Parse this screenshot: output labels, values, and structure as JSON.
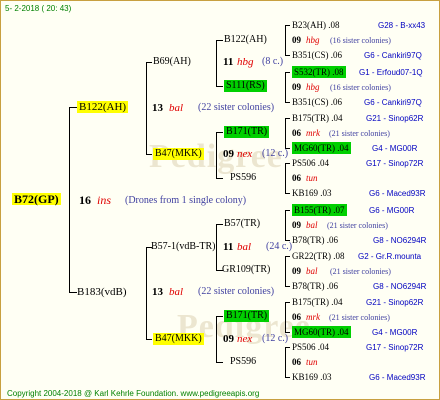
{
  "header": {
    "date": "5- 2-2018 ( 20: 43)"
  },
  "watermark": "Pedigree",
  "gen1": {
    "id": "B72(GP)",
    "num": "16",
    "mark": "ins",
    "note": "(Drones from 1 single colony)"
  },
  "gen2": [
    {
      "id": "B122(AH)",
      "num": "13",
      "mark": "bal",
      "note": "(22 sister colonies)"
    },
    {
      "id": "B183(vdB)",
      "num": "13",
      "mark": "bal",
      "note": "(22 sister colonies)"
    }
  ],
  "gen3": [
    {
      "id": "B69(AH)",
      "num": "11",
      "mark": "hbg",
      "note": "(8 c.)"
    },
    {
      "id": "B47(MKK)",
      "num": "09",
      "mark": "nex",
      "note": "(12 c.)"
    },
    {
      "id": "B57-1(vdB-TR)",
      "num": "11",
      "mark": "bal",
      "note": "(24 c.)"
    },
    {
      "id": "B47(MKK)",
      "num": "09",
      "mark": "nex",
      "note": "(12 c.)"
    }
  ],
  "gen4": [
    "B122(AH)",
    "S111(RS)",
    "B171(TR)",
    "PS596",
    "B57(TR)",
    "GR109(TR)",
    "B171(TR)",
    "PS596"
  ],
  "gen5": [
    {
      "id": "B23(AH) .08",
      "loc": "G28 - B-xx43"
    },
    {
      "num": "09",
      "mark": "hbg",
      "note": "(16 sister colonies)"
    },
    {
      "id": "B351(CS) .06",
      "loc": "G6 - Cankiri97Q"
    },
    {
      "id": "S532(TR) .08",
      "loc": "G1 - Erfoud07-1Q"
    },
    {
      "num": "09",
      "mark": "hbg",
      "note": "(16 sister colonies)"
    },
    {
      "id": "B351(CS) .06",
      "loc": "G6 - Cankiri97Q"
    },
    {
      "id": "B175(TR) .04",
      "loc": "G21 - Sinop62R"
    },
    {
      "num": "06",
      "mark": "mrk",
      "note": "(21 sister colonies)"
    },
    {
      "id": "MG60(TR) .04",
      "loc": "G4 - MG00R"
    },
    {
      "id": "PS506 .04",
      "loc": "G17 - Sinop72R"
    },
    {
      "num": "06",
      "mark": "tun",
      "note": ""
    },
    {
      "id": "KB169 .03",
      "loc": "G6 - Maced93R"
    },
    {
      "id": "B155(TR) .07",
      "loc": "G6 - MG00R"
    },
    {
      "num": "09",
      "mark": "bal",
      "note": "(21 sister colonies)"
    },
    {
      "id": "B78(TR) .06",
      "loc": "G8 - NO6294R"
    },
    {
      "id": "GR22(TR) .08",
      "loc": "G2 - Gr.R.mounta"
    },
    {
      "num": "09",
      "mark": "bal",
      "note": "(21 sister colonies)"
    },
    {
      "id": "B78(TR) .06",
      "loc": "G8 - NO6294R"
    },
    {
      "id": "B175(TR) .04",
      "loc": "G21 - Sinop62R"
    },
    {
      "num": "06",
      "mark": "mrk",
      "note": "(21 sister colonies)"
    },
    {
      "id": "MG60(TR) .04",
      "loc": "G4 - MG00R"
    },
    {
      "id": "PS506 .04",
      "loc": "G17 - Sinop72R"
    },
    {
      "num": "06",
      "mark": "tun",
      "note": ""
    },
    {
      "id": "KB169 .03",
      "loc": "G6 - Maced93R"
    }
  ],
  "footer": "Copyright 2004-2018 @ Karl Kehrle Foundation.   www.pedigreeapis.org",
  "colors": {
    "highlight_yellow": "#ffff00",
    "highlight_green": "#00d000",
    "mark_red": "#e00000",
    "location_blue": "#0000c0",
    "footer_green": "#008000"
  }
}
